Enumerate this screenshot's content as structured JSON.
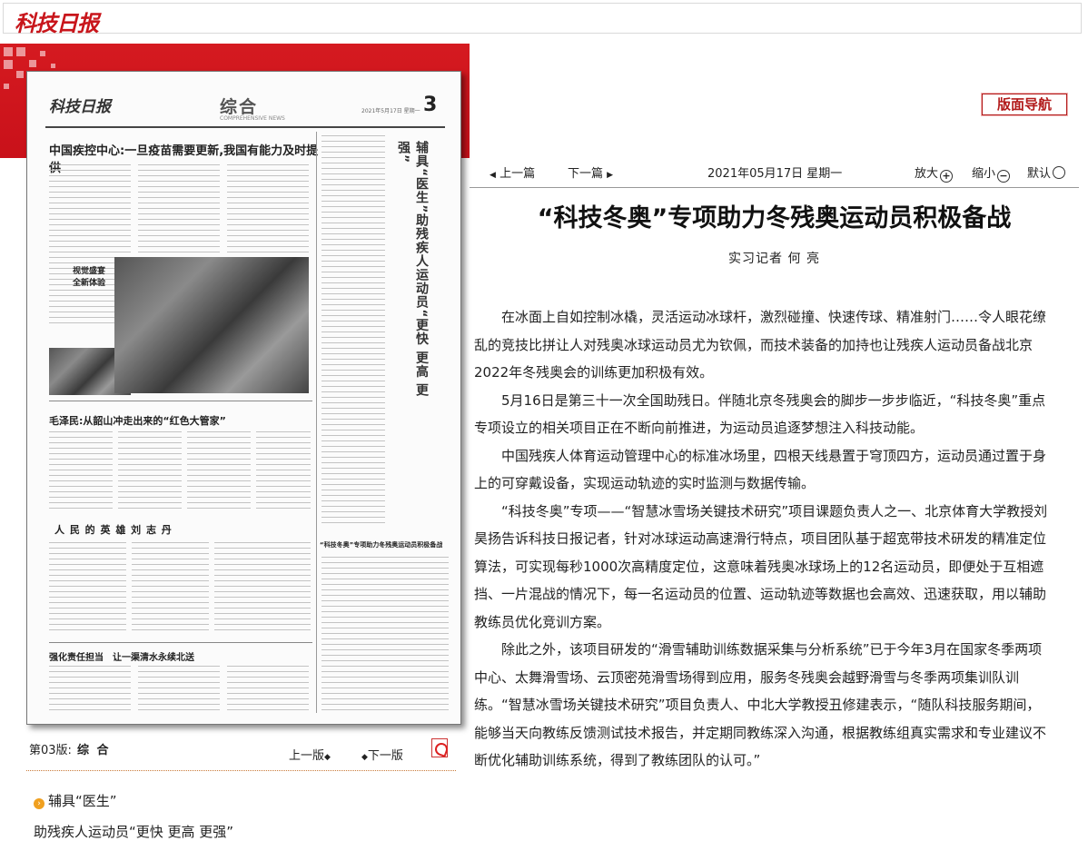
{
  "site": {
    "logo": "科技日报"
  },
  "nav_button": "版面导航",
  "toolbar": {
    "prev_article": "上一篇",
    "next_article": "下一篇",
    "date": "2021年05月17日 星期一",
    "zoom_in": "放大",
    "zoom_out": "缩小",
    "default": "默认"
  },
  "article": {
    "title": "“科技冬奥”专项助力冬残奥运动员积极备战",
    "author": "实习记者 何 亮",
    "paragraphs": [
      "在冰面上自如控制冰橇，灵活运动冰球杆，激烈碰撞、快速传球、精准射门……令人眼花缭乱的竞技比拼让人对残奥冰球运动员尤为钦佩，而技术装备的加持也让残疾人运动员备战北京2022年冬残奥会的训练更加积极有效。",
      "5月16日是第三十一次全国助残日。伴随北京冬残奥会的脚步一步步临近，“科技冬奥”重点专项设立的相关项目正在不断向前推进，为运动员追逐梦想注入科技动能。",
      "中国残疾人体育运动管理中心的标准冰场里，四根天线悬置于穹顶四方，运动员通过置于身上的可穿戴设备，实现运动轨迹的实时监测与数据传输。",
      "“科技冬奥”专项——“智慧冰雪场关键技术研究”项目课题负责人之一、北京体育大学教授刘昊扬告诉科技日报记者，针对冰球运动高速滑行特点，项目团队基于超宽带技术研发的精准定位算法，可实现每秒1000次高精度定位，这意味着残奥冰球场上的12名运动员，即便处于互相遮挡、一片混战的情况下，每一名运动员的位置、运动轨迹等数据也会高效、迅速获取，用以辅助教练员优化竞训方案。",
      "除此之外，该项目研发的“滑雪辅助训练数据采集与分析系统”已于今年3月在国家冬季两项中心、太舞滑雪场、云顶密苑滑雪场得到应用，服务冬残奥会越野滑雪与冬季两项集训队训练。“智慧冰雪场关键技术研究”项目负责人、中北大学教授丑修建表示，“随队科技服务期间，能够当天向教练反馈测试技术报告，并定期同教练深入沟通，根据教练组真实需求和专业建议不断优化辅助训练系统，得到了教练团队的认可。”"
    ]
  },
  "newspaper": {
    "masthead": "科技日报",
    "section": "综合",
    "section_en": "COMPREHENSIVE NEWS",
    "page_number": "3",
    "page_meta": "2021年5月17日 星期一",
    "headlines": [
      "中国疾控中心:一旦疫苗需要更新,我国有能力及时提供",
      "视觉盛宴\n全新体验",
      "毛泽民:从韶山冲走出来的“红色大管家”",
      "人 民 的 英 雄 刘 志 丹",
      "强化责任担当　让一渠清水永续北送",
      "“科技冬奥”专项助力冬残奥运动员积极备战"
    ],
    "vertical_headline": "辅具“医生”助残疾人运动员“更快 更高 更强”"
  },
  "page_info": {
    "label": "第03版:",
    "section": "综 合"
  },
  "page_nav": {
    "prev": "上一版",
    "next": "下一版"
  },
  "article_list": [
    "辅具“医生”",
    "助残疾人运动员“更快 更高 更强”"
  ]
}
